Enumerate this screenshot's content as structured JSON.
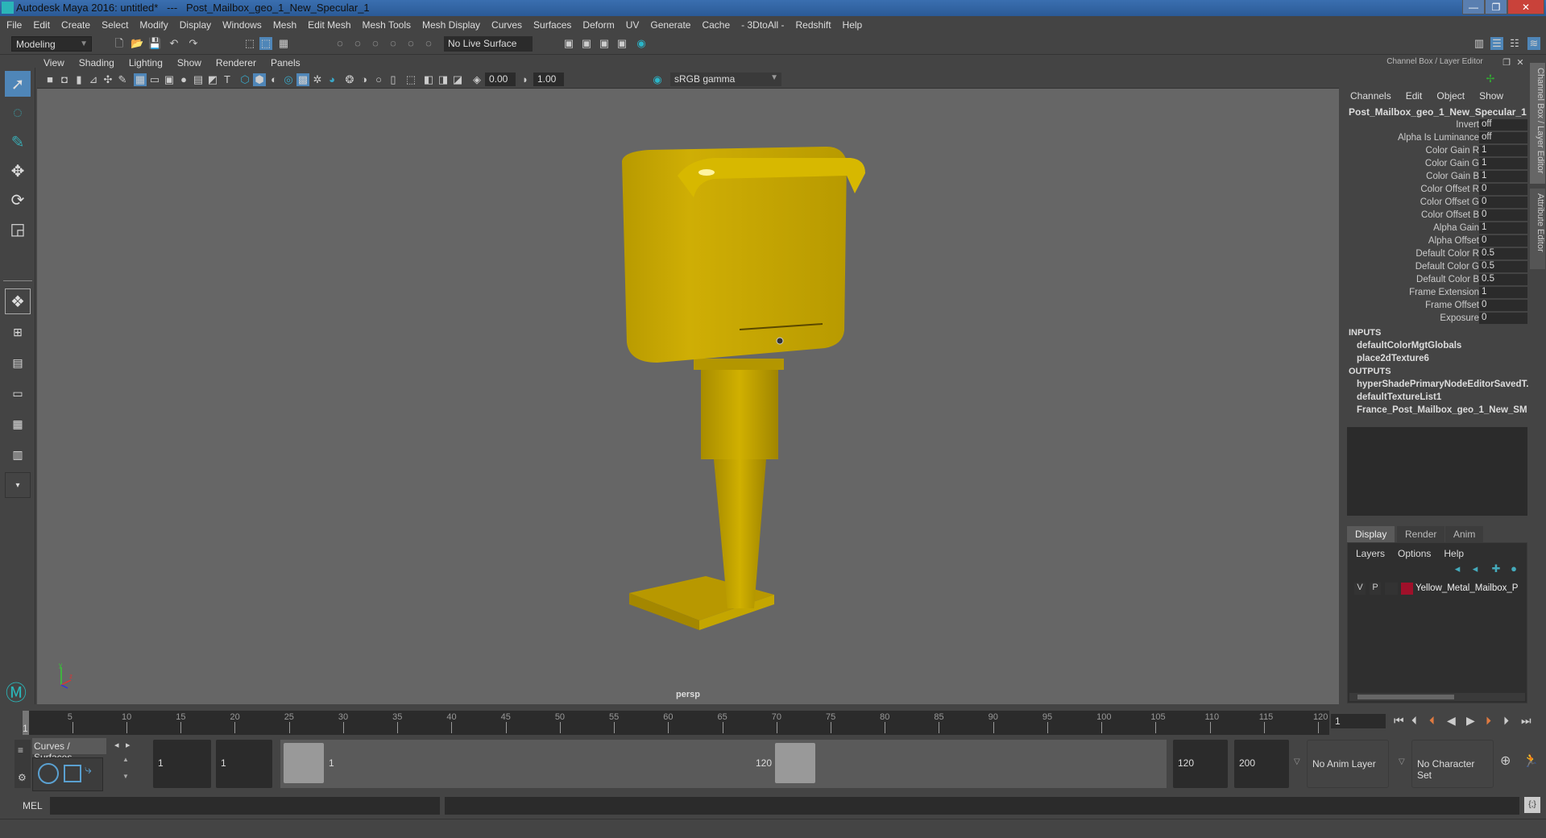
{
  "window": {
    "title": "Autodesk Maya 2016: untitled*   ---   Post_Mailbox_geo_1_New_Specular_1",
    "minimize": "—",
    "restore": "❐",
    "close": "✕"
  },
  "menubar": [
    "File",
    "Edit",
    "Create",
    "Select",
    "Modify",
    "Display",
    "Windows",
    "Mesh",
    "Edit Mesh",
    "Mesh Tools",
    "Mesh Display",
    "Curves",
    "Surfaces",
    "Deform",
    "UV",
    "Generate",
    "Cache",
    "- 3DtoAll -",
    "Redshift",
    "Help"
  ],
  "shelf": {
    "mode": "Modeling",
    "live_surface": "No Live Surface"
  },
  "viewport": {
    "menu": [
      "View",
      "Shading",
      "Lighting",
      "Show",
      "Renderer",
      "Panels"
    ],
    "exposure": "0.00",
    "gamma": "1.00",
    "color_management": "sRGB gamma",
    "camera_label": "persp",
    "model_color": "#c9a800"
  },
  "channel_box": {
    "header": "Channel Box / Layer Editor",
    "menu": [
      "Channels",
      "Edit",
      "Object",
      "Show"
    ],
    "object_name": "Post_Mailbox_geo_1_New_Specular_1",
    "attributes": [
      {
        "label": "Invert",
        "value": "off"
      },
      {
        "label": "Alpha Is Luminance",
        "value": "off"
      },
      {
        "label": "Color Gain R",
        "value": "1"
      },
      {
        "label": "Color Gain G",
        "value": "1"
      },
      {
        "label": "Color Gain B",
        "value": "1"
      },
      {
        "label": "Color Offset R",
        "value": "0"
      },
      {
        "label": "Color Offset G",
        "value": "0"
      },
      {
        "label": "Color Offset B",
        "value": "0"
      },
      {
        "label": "Alpha Gain",
        "value": "1"
      },
      {
        "label": "Alpha Offset",
        "value": "0"
      },
      {
        "label": "Default Color R",
        "value": "0.5"
      },
      {
        "label": "Default Color G",
        "value": "0.5"
      },
      {
        "label": "Default Color B",
        "value": "0.5"
      },
      {
        "label": "Frame Extension",
        "value": "1"
      },
      {
        "label": "Frame Offset",
        "value": "0"
      },
      {
        "label": "Exposure",
        "value": "0"
      }
    ],
    "inputs_label": "INPUTS",
    "inputs": [
      "defaultColorMgtGlobals",
      "place2dTexture6"
    ],
    "outputs_label": "OUTPUTS",
    "outputs": [
      "hyperShadePrimaryNodeEditorSavedT...",
      "defaultTextureList1",
      "France_Post_Mailbox_geo_1_New_SM"
    ]
  },
  "layer_editor": {
    "tabs": [
      "Display",
      "Render",
      "Anim"
    ],
    "active_tab": "Display",
    "menu": [
      "Layers",
      "Options",
      "Help"
    ],
    "layers": [
      {
        "v": "V",
        "p": "P",
        "color": "#a0102a",
        "name": "Yellow_Metal_Mailbox_P"
      }
    ]
  },
  "side_tabs": [
    "Channel Box / Layer Editor",
    "Attribute Editor"
  ],
  "timeline": {
    "ticks": [
      5,
      10,
      15,
      20,
      25,
      30,
      35,
      40,
      45,
      50,
      55,
      60,
      65,
      70,
      75,
      80,
      85,
      90,
      95,
      100,
      105,
      110,
      115,
      120
    ],
    "start_label": "1",
    "current_frame": "1"
  },
  "range": {
    "shelf_tab": "Curves / Surfaces",
    "start": "1",
    "min": "1",
    "slider_start": "1",
    "slider_end": "120",
    "end": "120",
    "max": "200",
    "anim_layer": "No Anim Layer",
    "character_set": "No Character Set"
  },
  "command": {
    "label": "MEL"
  }
}
